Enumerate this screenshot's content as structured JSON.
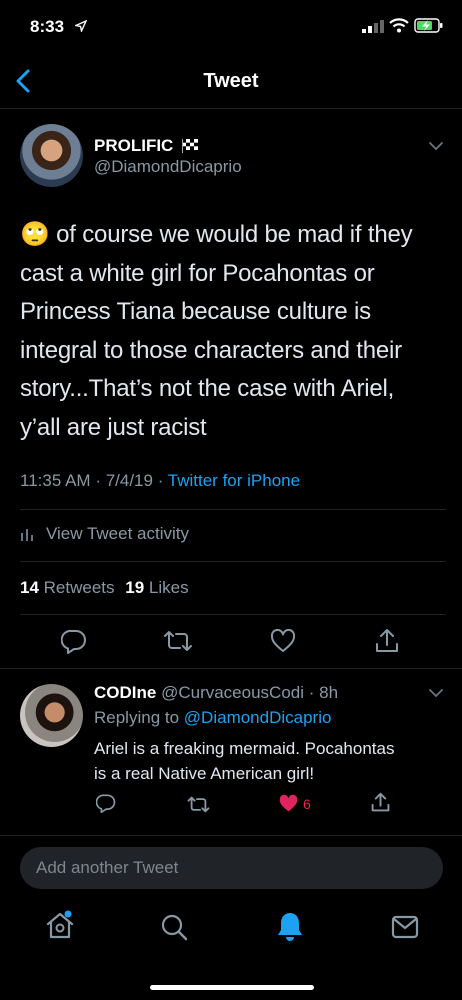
{
  "status_bar": {
    "time": "8:33"
  },
  "header": {
    "title": "Tweet"
  },
  "tweet": {
    "display_name": "PROLIFIC",
    "handle": "@DiamondDicaprio",
    "emoji": "🙄",
    "lines": [
      "of course we would be mad if they",
      "cast a white girl for Pocahontas or",
      "Princess Tiana because culture is",
      "integral to those characters and their",
      "story...That’s not the case with Ariel,",
      "y’all are just racist"
    ],
    "time": "11:35 AM",
    "date": "7/4/19",
    "source": "Twitter for iPhone",
    "activity_label": "View Tweet activity",
    "retweets_count": "14",
    "retweets_label": "Retweets",
    "likes_count": "19",
    "likes_label": "Likes"
  },
  "reply": {
    "display_name": "CODIne",
    "handle": "@CurvaceousCodi",
    "age": "8h",
    "replying_prefix": "Replying to",
    "replying_to": "@DiamondDicaprio",
    "lines": [
      "Ariel is a freaking mermaid. Pocahontas",
      "is a real Native American girl!"
    ],
    "like_count": "6"
  },
  "composer": {
    "placeholder": "Add another Tweet"
  },
  "colors": {
    "accent": "#1da1f2",
    "like": "#e0245e",
    "background": "#000000",
    "muted": "#8899a6"
  }
}
